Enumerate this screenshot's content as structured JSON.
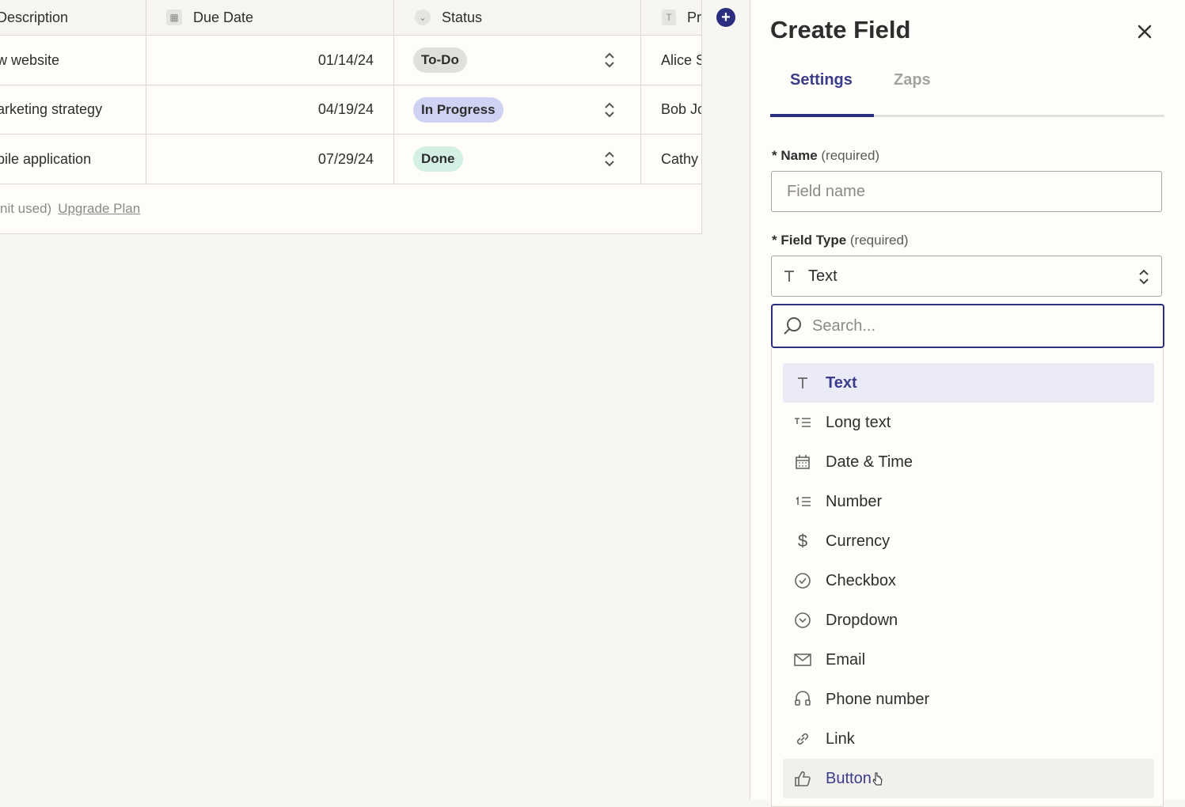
{
  "table": {
    "headers": {
      "description": "Description",
      "due_date": "Due Date",
      "status": "Status",
      "p": "Pr"
    },
    "rows": [
      {
        "description": "w website",
        "due_date": "01/14/24",
        "status": "To-Do",
        "p": "Alice S"
      },
      {
        "description": "arketing strategy",
        "due_date": "04/19/24",
        "status": "In Progress",
        "p": "Bob Jo"
      },
      {
        "description": "bile application",
        "due_date": "07/29/24",
        "status": "Done",
        "p": "Cathy"
      }
    ],
    "footer": {
      "usage": "nit used)",
      "upgrade": "Upgrade Plan"
    }
  },
  "panel": {
    "title": "Create Field",
    "tabs": [
      "Settings",
      "Zaps"
    ],
    "name_label": "Name",
    "name_req": "(required)",
    "name_placeholder": "Field name",
    "type_label": "Field Type",
    "type_req": "(required)",
    "type_value": "Text",
    "search_placeholder": "Search...",
    "options": [
      {
        "label": "Text",
        "icon": "text-icon"
      },
      {
        "label": "Long text",
        "icon": "long-text-icon"
      },
      {
        "label": "Date & Time",
        "icon": "calendar-icon"
      },
      {
        "label": "Number",
        "icon": "number-icon"
      },
      {
        "label": "Currency",
        "icon": "dollar-icon"
      },
      {
        "label": "Checkbox",
        "icon": "check-circle-icon"
      },
      {
        "label": "Dropdown",
        "icon": "chevron-circle-icon"
      },
      {
        "label": "Email",
        "icon": "envelope-icon"
      },
      {
        "label": "Phone number",
        "icon": "phone-icon"
      },
      {
        "label": "Link",
        "icon": "link-icon"
      },
      {
        "label": "Button",
        "icon": "thumbs-up-icon"
      }
    ]
  },
  "colors": {
    "accent": "#2b2d7e",
    "selected_bg": "#ebebf7"
  }
}
